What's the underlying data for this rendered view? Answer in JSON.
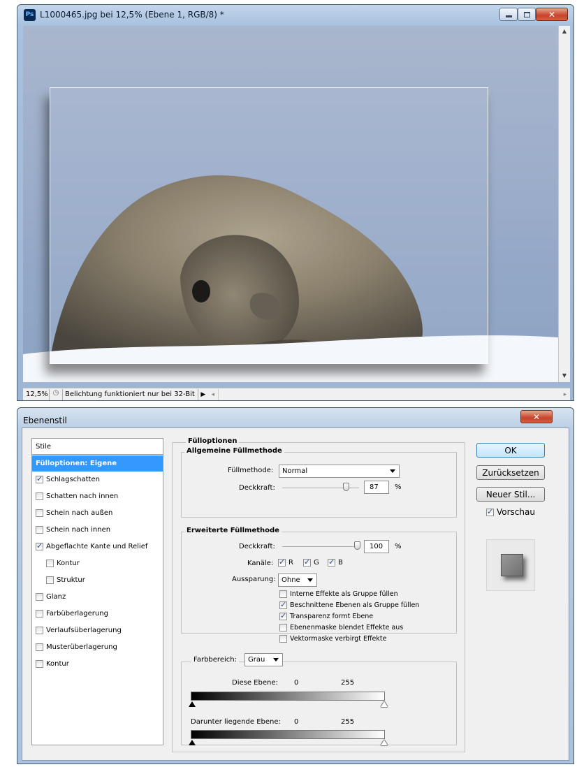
{
  "document": {
    "app_badge": "Ps",
    "title": "L1000465.jpg bei 12,5% (Ebene 1, RGB/8) *",
    "zoom": "12,5%",
    "status_text": "Belichtung funktioniert nur bei 32-Bit"
  },
  "dialog": {
    "title": "Ebenenstil",
    "styles_header": "Stile",
    "style_items": [
      {
        "label": "Fülloptionen: Eigene",
        "selected": true
      },
      {
        "label": "Schlagschatten",
        "checked": true
      },
      {
        "label": "Schatten nach innen",
        "checked": false
      },
      {
        "label": "Schein nach außen",
        "checked": false
      },
      {
        "label": "Schein nach innen",
        "checked": false
      },
      {
        "label": "Abgeflachte Kante und Relief",
        "checked": true
      },
      {
        "label": "Kontur",
        "checked": false,
        "indent": true
      },
      {
        "label": "Struktur",
        "checked": false,
        "indent": true
      },
      {
        "label": "Glanz",
        "checked": false
      },
      {
        "label": "Farbüberlagerung",
        "checked": false
      },
      {
        "label": "Verlaufsüberlagerung",
        "checked": false
      },
      {
        "label": "Musterüberlagerung",
        "checked": false
      },
      {
        "label": "Kontur",
        "checked": false
      }
    ],
    "fill_options": {
      "title": "Fülloptionen",
      "general": {
        "title": "Allgemeine Füllmethode",
        "blend_mode_label": "Füllmethode:",
        "blend_mode_value": "Normal",
        "opacity_label": "Deckkraft:",
        "opacity_value": "87",
        "opacity_unit": "%"
      },
      "advanced": {
        "title": "Erweiterte Füllmethode",
        "fill_opacity_label": "Deckkraft:",
        "fill_opacity_value": "100",
        "fill_opacity_unit": "%",
        "channels_label": "Kanäle:",
        "channels": [
          {
            "label": "R",
            "checked": true
          },
          {
            "label": "G",
            "checked": true
          },
          {
            "label": "B",
            "checked": true
          }
        ],
        "knockout_label": "Aussparung:",
        "knockout_value": "Ohne",
        "options": [
          {
            "label": "Interne Effekte als Gruppe füllen",
            "checked": false
          },
          {
            "label": "Beschnittene Ebenen als Gruppe füllen",
            "checked": true
          },
          {
            "label": "Transparenz formt Ebene",
            "checked": true
          },
          {
            "label": "Ebenenmaske blendet Effekte aus",
            "checked": false
          },
          {
            "label": "Vektormaske verbirgt Effekte",
            "checked": false
          }
        ]
      },
      "blend_if": {
        "label": "Farbbereich:",
        "value": "Grau",
        "this_layer_label": "Diese Ebene:",
        "this_layer_min": "0",
        "this_layer_max": "255",
        "underlying_label": "Darunter liegende Ebene:",
        "underlying_min": "0",
        "underlying_max": "255"
      }
    },
    "buttons": {
      "ok": "OK",
      "reset": "Zurücksetzen",
      "new_style": "Neuer Stil...",
      "preview_label": "Vorschau",
      "preview_checked": true
    }
  }
}
